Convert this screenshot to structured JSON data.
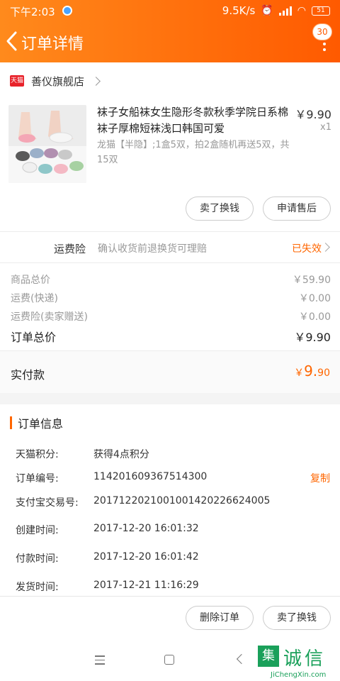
{
  "status_bar": {
    "time": "下午2:03",
    "network_speed": "9.5K/s",
    "battery": "51"
  },
  "header": {
    "title": "订单详情",
    "message_count": "30"
  },
  "store": {
    "logo_text": "天猫",
    "name": "善仪旗舰店"
  },
  "product": {
    "title": "袜子女船袜女生隐形冬款秋季学院日系棉袜子厚棉短袜浅口韩国可爱",
    "sku": "龙猫【半隐】;1盒5双，拍2盒随机再送5双，共15双",
    "price": "￥9.90",
    "quantity": "x1"
  },
  "item_actions": {
    "resell": "卖了换钱",
    "after_sale": "申请售后"
  },
  "shipping_insurance": {
    "label": "运费险",
    "desc": "确认收货前退换货可理赔",
    "status": "已失效"
  },
  "fees": {
    "goods_total_label": "商品总价",
    "goods_total": "￥59.90",
    "shipping_label": "运费(快递)",
    "shipping": "￥0.00",
    "insurance_label": "运费险(卖家赠送)",
    "insurance": "￥0.00",
    "order_total_label": "订单总价",
    "order_total": "￥9.90"
  },
  "paid": {
    "label": "实付款",
    "currency": "￥",
    "integer": "9.",
    "decimal": "90"
  },
  "order_info": {
    "title": "订单信息",
    "rows": [
      {
        "key": "天猫积分:",
        "value": "获得4点积分"
      },
      {
        "key": "订单编号:",
        "value": "114201609367514300"
      },
      {
        "key": "支付宝交易号:",
        "value": "2017122021001001420226624005"
      },
      {
        "key": "创建时间:",
        "value": "2017-12-20 16:01:32"
      },
      {
        "key": "付款时间:",
        "value": "2017-12-20 16:01:42"
      },
      {
        "key": "发货时间:",
        "value": "2017-12-21 11:16:29"
      }
    ],
    "copy_label": "复制"
  },
  "bottom_actions": {
    "delete": "删除订单",
    "resell": "卖了换钱"
  },
  "watermark": {
    "box_char": "集",
    "text": "诚信",
    "url": "JiChengXin.com"
  },
  "colors": {
    "accent": "#ff6600",
    "header_start": "#ff8a1c",
    "header_end": "#ff5a00"
  }
}
